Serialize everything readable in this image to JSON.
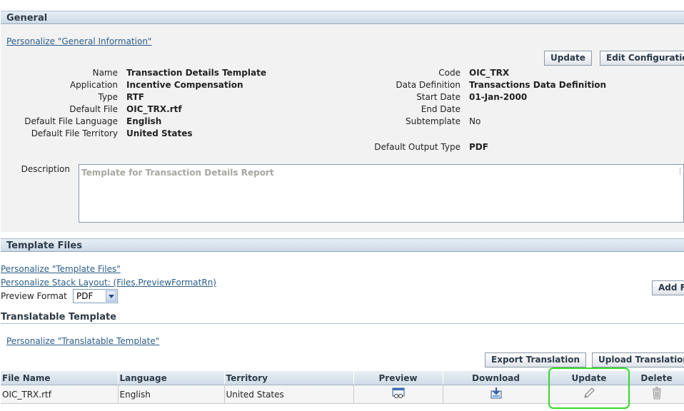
{
  "general": {
    "section_title": "General",
    "personalize_link": "Personalize \"General Information\"",
    "update_button": "Update",
    "edit_config_button": "Edit Configuration",
    "left_fields": [
      {
        "label": "Name",
        "value": "Transaction Details Template"
      },
      {
        "label": "Application",
        "value": "Incentive Compensation"
      },
      {
        "label": "Type",
        "value": "RTF"
      },
      {
        "label": "Default File",
        "value": "OIC_TRX.rtf"
      },
      {
        "label": "Default File Language",
        "value": "English"
      },
      {
        "label": "Default File Territory",
        "value": "United States"
      }
    ],
    "right_fields": [
      {
        "label": "Code",
        "value": "OIC_TRX"
      },
      {
        "label": "Data Definition",
        "value": "Transactions Data Definition"
      },
      {
        "label": "Start Date",
        "value": "01-Jan-2000"
      },
      {
        "label": "End Date",
        "value": ""
      },
      {
        "label": "Subtemplate",
        "value": "No"
      }
    ],
    "output_type": {
      "label": "Default Output Type",
      "value": "PDF"
    },
    "description": {
      "label": "Description",
      "value": "Template for Transaction Details Report"
    }
  },
  "template_files": {
    "section_title": "Template Files",
    "personalize_link": "Personalize \"Template Files\"",
    "stack_layout_link": "Personalize Stack Layout: (Files.PreviewFormatRn)",
    "preview_format_label": "Preview Format",
    "preview_format_value": "PDF",
    "add_button": "Add F"
  },
  "translatable": {
    "title": "Translatable Template",
    "personalize_link": "Personalize \"Translatable Template\"",
    "export_button": "Export Translation",
    "upload_button": "Upload Translation",
    "columns": [
      "File Name",
      "Language",
      "Territory",
      "Preview",
      "Download",
      "Update",
      "Delete"
    ],
    "rows": [
      {
        "file_name": "OIC_TRX.rtf",
        "language": "English",
        "territory": "United States"
      }
    ]
  },
  "colors": {
    "highlight": "#35d92a",
    "link": "#2a5e8a"
  }
}
